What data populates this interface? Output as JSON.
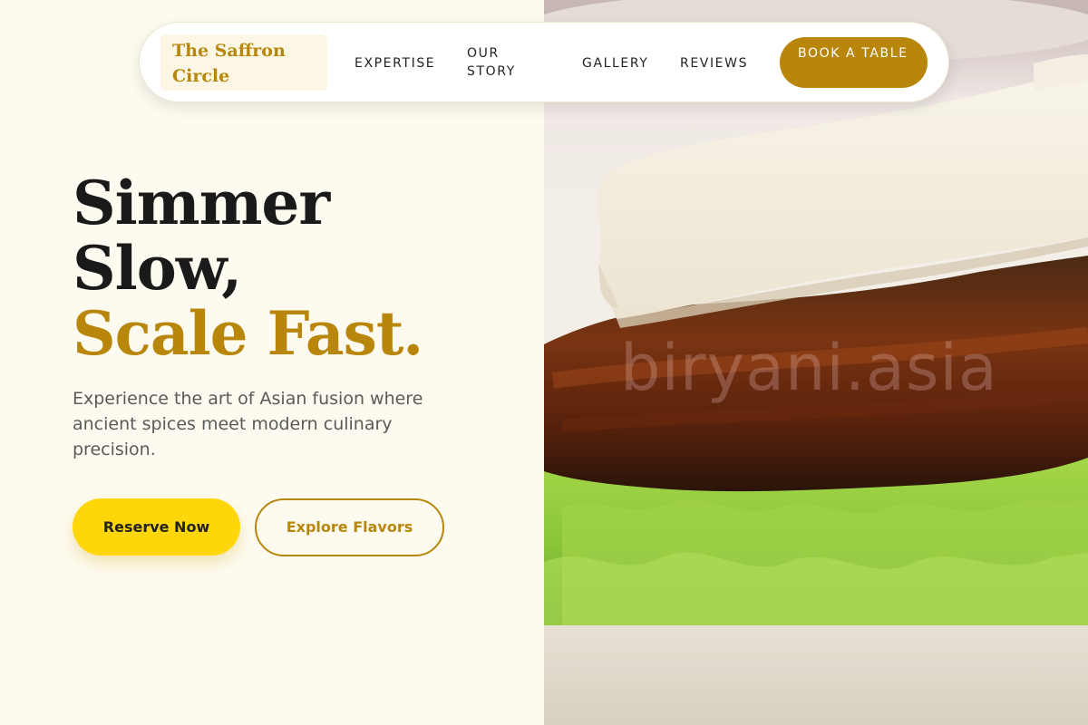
{
  "brand": {
    "name": "The Saffron Circle"
  },
  "nav": {
    "items": [
      {
        "label": "EXPERTISE"
      },
      {
        "label": "OUR STORY"
      },
      {
        "label": "GALLERY"
      },
      {
        "label": "REVIEWS"
      }
    ],
    "cta_label": "BOOK A TABLE"
  },
  "hero": {
    "title_line1": "Simmer",
    "title_line2": "Slow,",
    "title_accent": "Scale Fast.",
    "description": "Experience the art of Asian fusion where ancient spices meet modern culinary precision.",
    "primary_button": "Reserve Now",
    "secondary_button": "Explore Flavors"
  },
  "image": {
    "subject": "bao-bun-with-pork-belly-and-lettuce",
    "watermark": "biryani.asia"
  },
  "colors": {
    "background": "#fdfbef",
    "accent_gold": "#b8860b",
    "primary_yellow": "#ffd60a",
    "text_dark": "#1a1a1a"
  }
}
